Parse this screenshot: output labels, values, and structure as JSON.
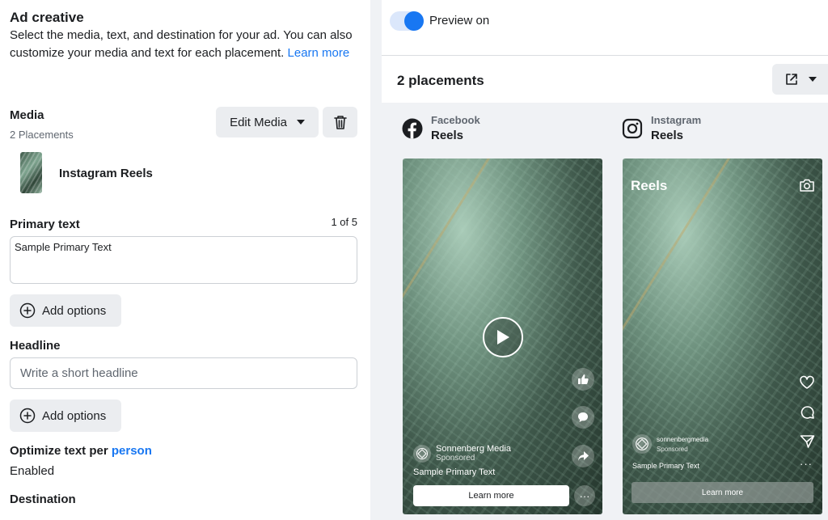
{
  "section": {
    "title": "Ad creative",
    "description": "Select the media, text, and destination for your ad. You can also customize your media and text for each placement.",
    "learn_more": "Learn more"
  },
  "media": {
    "label": "Media",
    "placements": "2 Placements",
    "edit_button": "Edit Media",
    "item_label": "Instagram Reels"
  },
  "primary_text": {
    "label": "Primary text",
    "count": "1 of 5",
    "value": "Sample Primary Text",
    "add_options": "Add options"
  },
  "headline": {
    "label": "Headline",
    "placeholder": "Write a short headline",
    "add_options": "Add options"
  },
  "optimize": {
    "label_prefix": "Optimize text per",
    "label_link": "person",
    "value": "Enabled"
  },
  "destination": {
    "label": "Destination"
  },
  "preview": {
    "toggle_label": "Preview on",
    "toggle_state": "on",
    "placements_title": "2 placements",
    "accent_color": "#1877f2"
  },
  "facebook": {
    "platform": "Facebook",
    "type": "Reels",
    "advertiser": "Sonnenberg Media",
    "sponsored": "Sponsored",
    "primary_text": "Sample Primary Text",
    "cta": "Learn more",
    "more": "···"
  },
  "instagram": {
    "platform": "Instagram",
    "type": "Reels",
    "header": "Reels",
    "advertiser": "sonnenbergmedia",
    "sponsored": "Sponsored",
    "primary_text": "Sample Primary Text",
    "cta": "Learn more",
    "more": "···"
  }
}
